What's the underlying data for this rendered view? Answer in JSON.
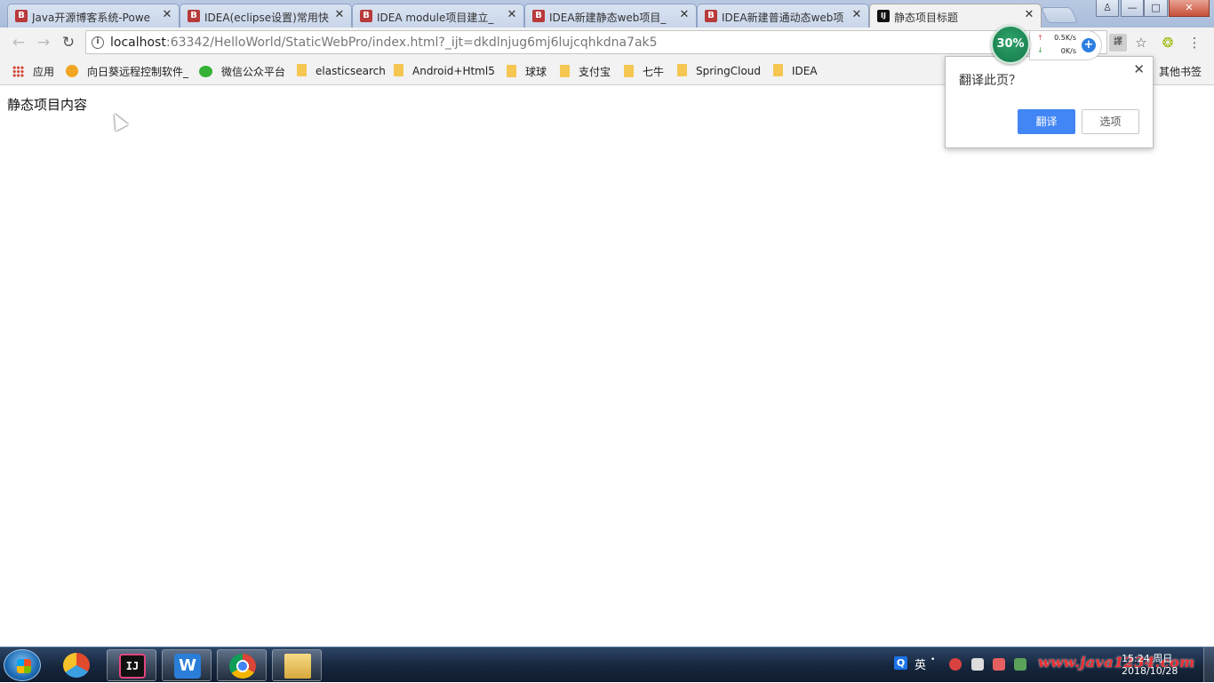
{
  "tabs": [
    {
      "favicon": "B",
      "title": "Java开源博客系统-Powe",
      "active": false
    },
    {
      "favicon": "B",
      "title": "IDEA(eclipse设置)常用快",
      "active": false
    },
    {
      "favicon": "B",
      "title": "IDEA module项目建立_",
      "active": false
    },
    {
      "favicon": "B",
      "title": "IDEA新建静态web项目_",
      "active": false
    },
    {
      "favicon": "B",
      "title": "IDEA新建普通动态web项",
      "active": false
    },
    {
      "favicon": "IJ",
      "title": "静态项目标题",
      "active": true
    }
  ],
  "window_controls": {
    "minimize": "—",
    "maximize": "□",
    "close": "✕"
  },
  "toolbar": {
    "back": "←",
    "forward": "→",
    "reload": "↻",
    "url_host": "localhost",
    "url_rest": ":63342/HelloWorld/StaticWebPro/index.html?_ijt=dkdlnjug6mj6lujcqhkdna7ak5",
    "bookmark_star": "☆",
    "menu": "⋮"
  },
  "net_monitor": {
    "percent": "30%",
    "up": "0.5K/s",
    "down": "0K/s"
  },
  "bookmarks": [
    {
      "icon": "apps-icon",
      "label": "应用"
    },
    {
      "icon": "sunflower-icon",
      "label": "向日葵远程控制软件_"
    },
    {
      "icon": "wechat-icon",
      "label": "微信公众平台"
    },
    {
      "icon": "folder-icon",
      "label": "elasticsearch"
    },
    {
      "icon": "folder-icon",
      "label": "Android+Html5"
    },
    {
      "icon": "folder-icon",
      "label": "球球"
    },
    {
      "icon": "folder-icon",
      "label": "支付宝"
    },
    {
      "icon": "folder-icon",
      "label": "七牛"
    },
    {
      "icon": "folder-icon",
      "label": "SpringCloud"
    },
    {
      "icon": "folder-icon",
      "label": "IDEA"
    }
  ],
  "other_bookmarks": "其他书签",
  "page": {
    "content": "静态项目内容"
  },
  "translate_popup": {
    "title": "翻译此页？",
    "translate_button": "翻译",
    "options_button": "选项",
    "close": "✕"
  },
  "taskbar": {
    "apps": [
      "photo-viewer",
      "intellij-idea",
      "wps",
      "chrome",
      "file-explorer"
    ],
    "intellij_label": "IJ",
    "wps_label": "W",
    "tray_lang_icon": "Q",
    "tray_lang": "英",
    "tray_dot": "•",
    "time": "15:24 周日",
    "date": "2018/10/28",
    "watermark": "www.java1234.com"
  },
  "colors": {
    "accent": "#4285f4",
    "tabstrip": "#b9c9e2",
    "taskbar": "#16263d"
  }
}
